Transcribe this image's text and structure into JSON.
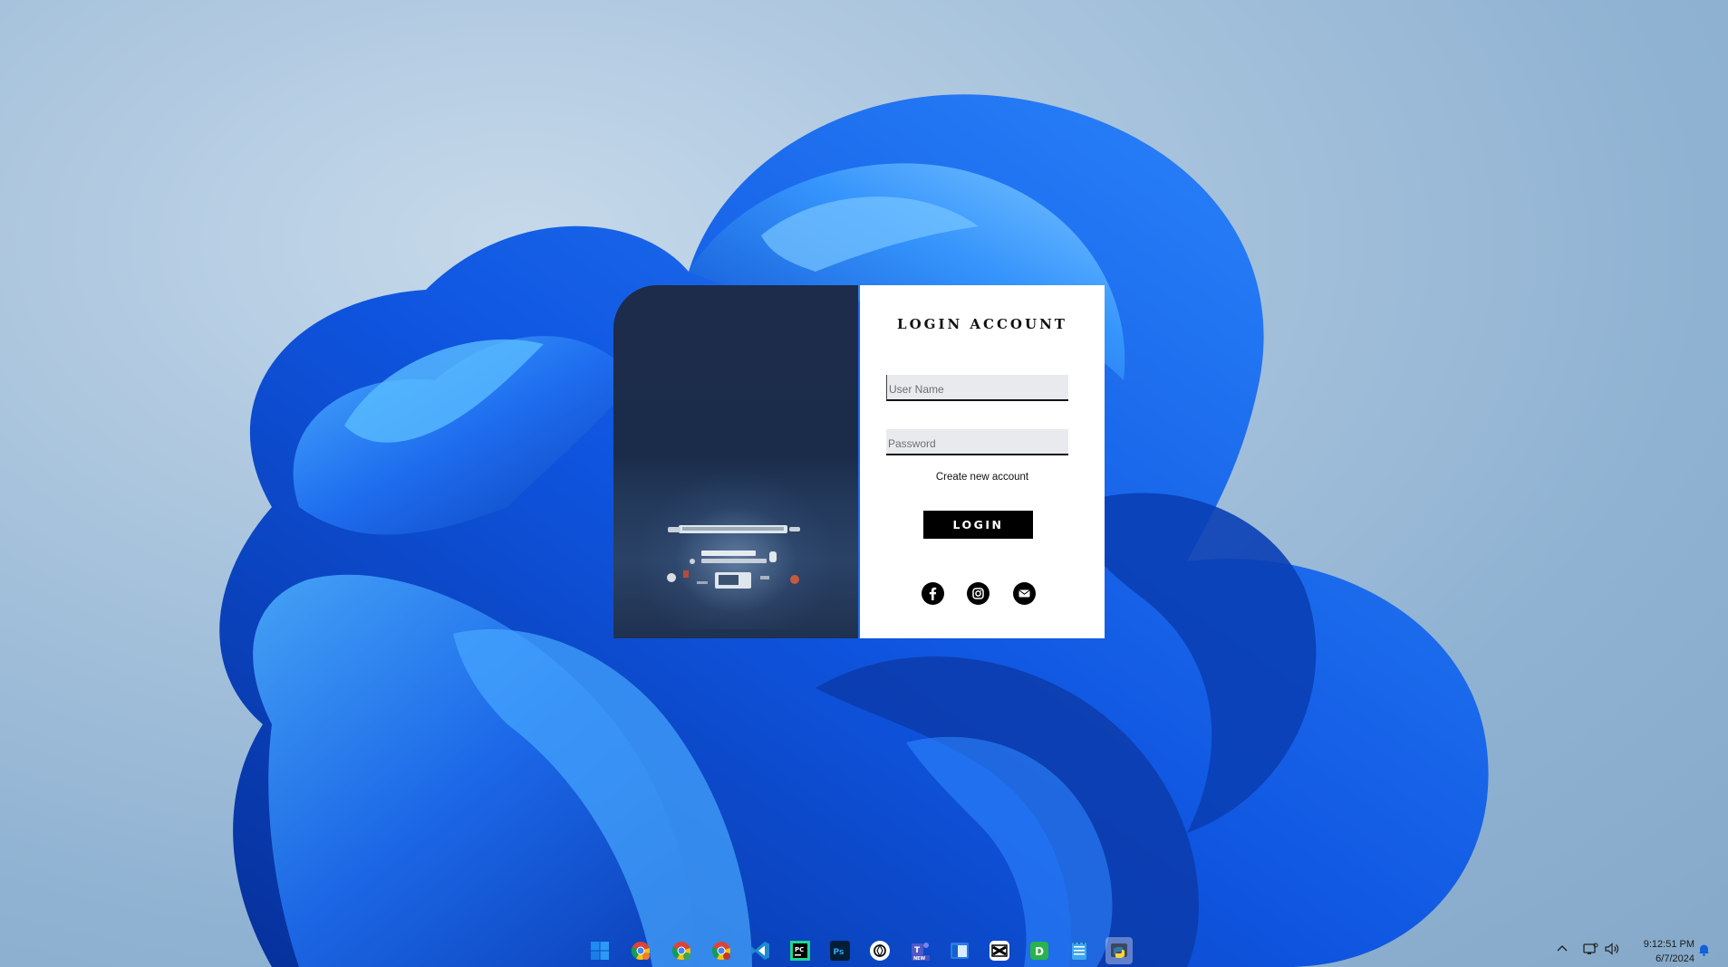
{
  "login": {
    "title": "LOGIN ACCOUNT",
    "username_placeholder": "User Name",
    "password_placeholder": "Password",
    "create_account": "Create new account",
    "login_button": "LOGIN",
    "social_icons": [
      "facebook-icon",
      "instagram-icon",
      "email-icon"
    ]
  },
  "taskbar": {
    "apps": [
      "windows-start-icon",
      "chrome-icon",
      "chrome-icon",
      "chrome-icon",
      "vscode-icon",
      "pycharm-icon",
      "photoshop-icon",
      "chatgpt-icon",
      "teams-icon",
      "app-window-icon",
      "capcut-icon",
      "d-app-icon",
      "notepad-icon",
      "python-app-icon"
    ],
    "teams_badge": "NEW",
    "clock": {
      "time": "9:12:51 PM",
      "date": "6/7/2024"
    }
  },
  "colors": {
    "login_panel_dark": "#1b2c4b",
    "accent_blue": "#1e6cf0",
    "button_black": "#000000"
  }
}
